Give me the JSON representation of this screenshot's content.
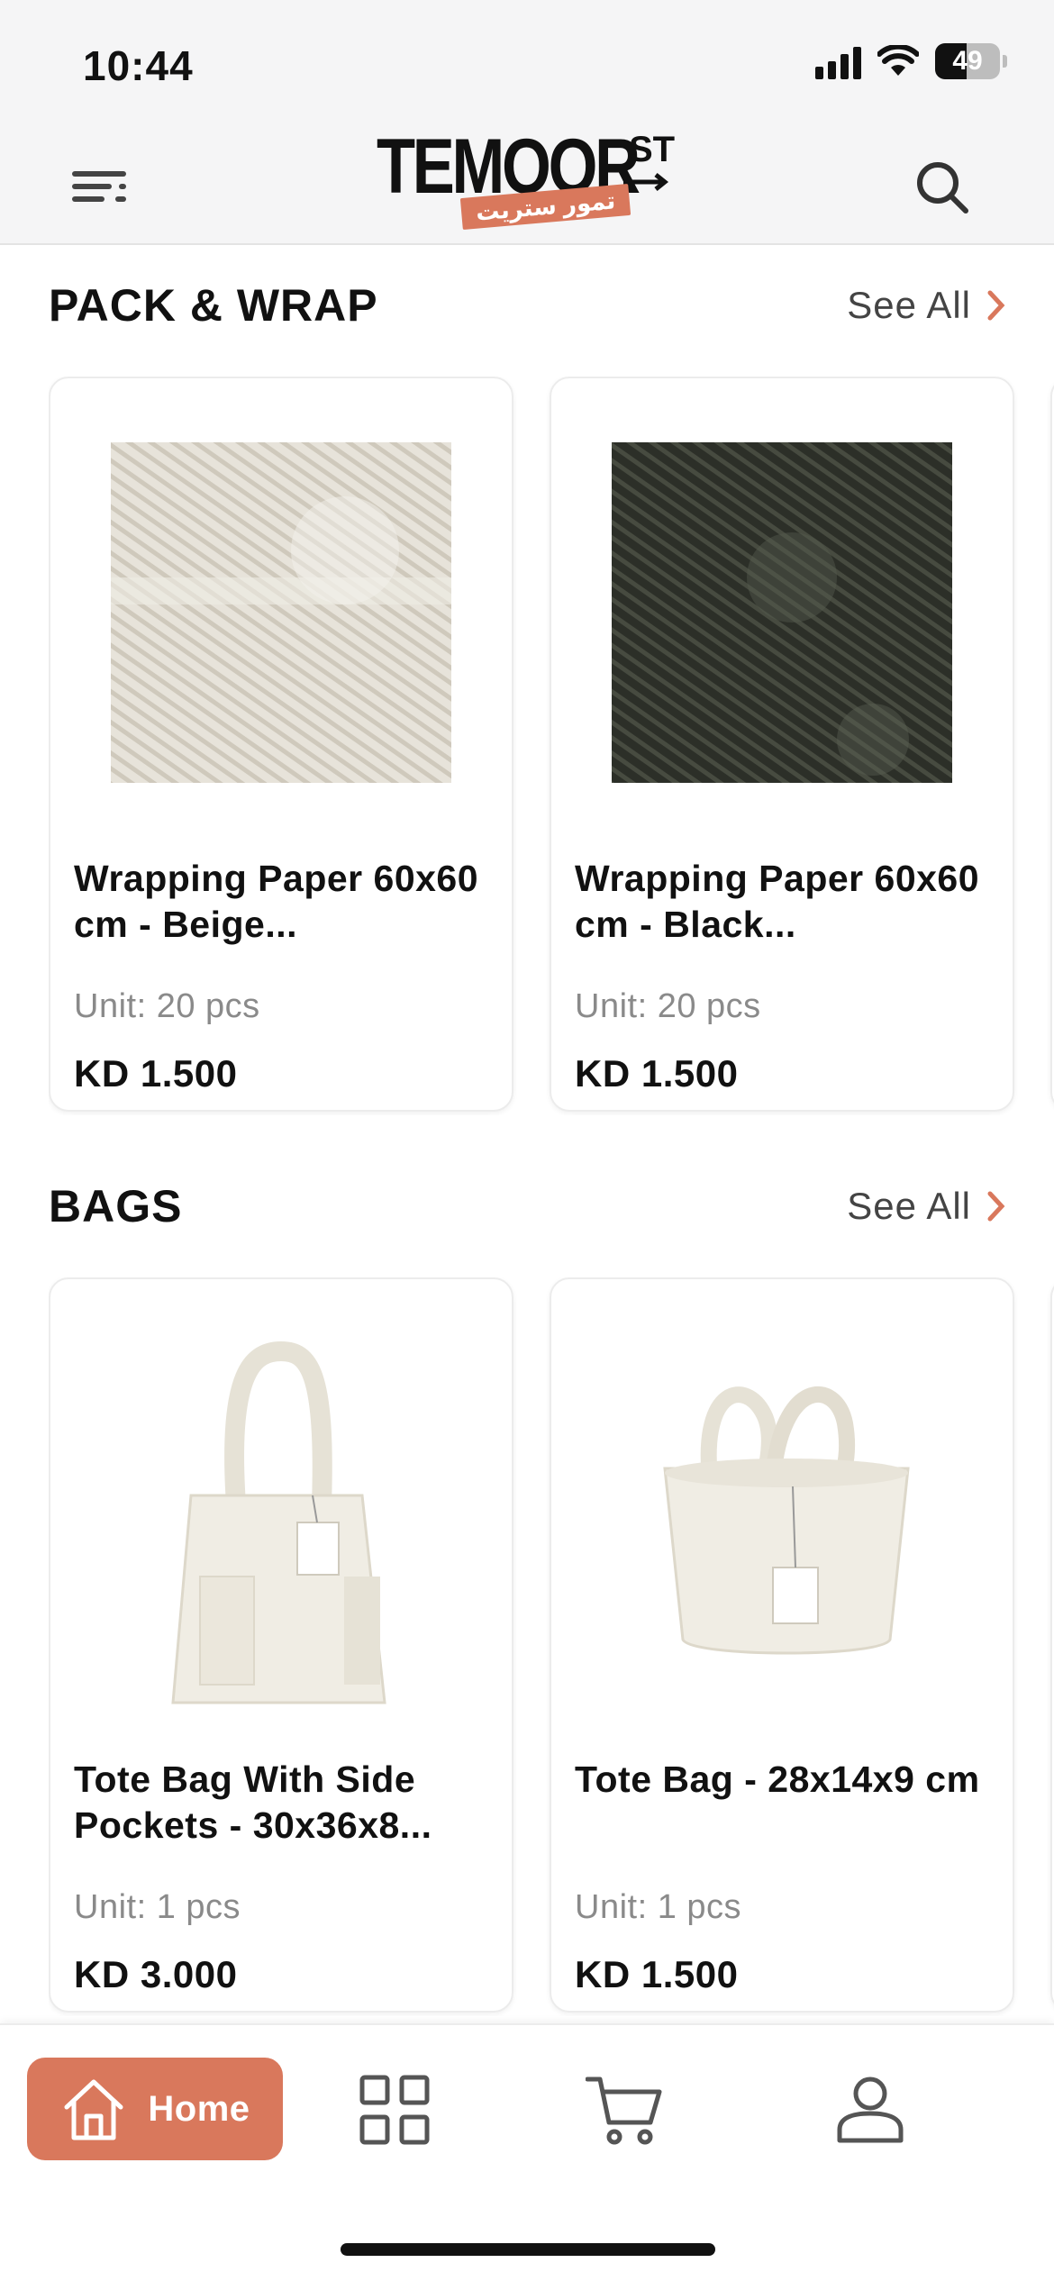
{
  "status_bar": {
    "time": "10:44",
    "battery": "49"
  },
  "header": {
    "logo_main": "TEMOOR",
    "logo_suffix": "ST",
    "logo_arabic": "تمور ستريت"
  },
  "sections": [
    {
      "title": "PACK & WRAP",
      "see_all": "See All",
      "products": [
        {
          "name": "Wrapping Paper 60x60 cm - Beige...",
          "unit": "Unit: 20 pcs",
          "price": "KD 1.500",
          "image": "beige-wrapping-paper"
        },
        {
          "name": "Wrapping Paper 60x60 cm - Black...",
          "unit": "Unit: 20 pcs",
          "price": "KD 1.500",
          "image": "black-wrapping-paper"
        }
      ]
    },
    {
      "title": "BAGS",
      "see_all": "See All",
      "products": [
        {
          "name": "Tote Bag With Side Pockets - 30x36x8...",
          "unit": "Unit: 1 pcs",
          "price": "KD 3.000",
          "image": "tall-tote-bag"
        },
        {
          "name": "Tote Bag - 28x14x9 cm",
          "unit": "Unit: 1 pcs",
          "price": "KD 1.500",
          "image": "short-tote-bag"
        }
      ]
    }
  ],
  "bottom_nav": {
    "active": "home",
    "items": [
      {
        "key": "home",
        "label": "Home",
        "icon": "home-icon"
      },
      {
        "key": "categories",
        "label": "",
        "icon": "grid-icon"
      },
      {
        "key": "cart",
        "label": "",
        "icon": "cart-icon"
      },
      {
        "key": "account",
        "label": "",
        "icon": "user-icon"
      }
    ]
  },
  "colors": {
    "accent": "#d9785c",
    "text": "#111111",
    "muted": "#8a8a8a",
    "header_bg": "#f5f5f6"
  }
}
